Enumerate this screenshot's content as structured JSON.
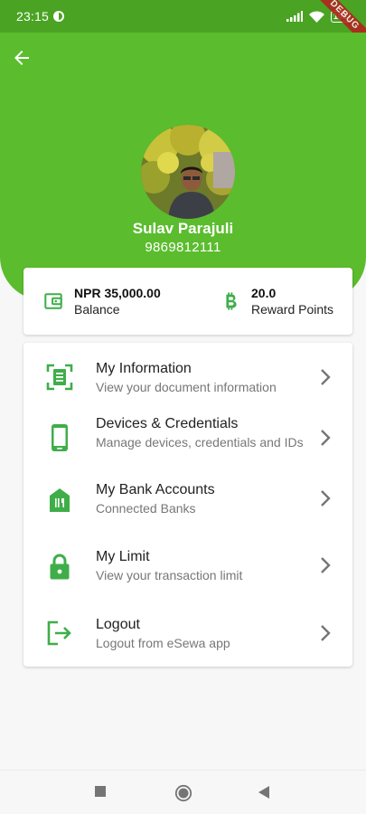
{
  "status": {
    "time": "23:15",
    "battery": "100",
    "debug_banner": "DEBUG"
  },
  "profile": {
    "name": "Sulav Parajuli",
    "phone": "9869812111"
  },
  "balance": {
    "amount": "NPR 35,000.00",
    "label": "Balance"
  },
  "rewards": {
    "amount": "20.0",
    "label": "Reward Points"
  },
  "menu": [
    {
      "title": "My Information",
      "subtitle": "View your document information",
      "icon": "document-scan-icon"
    },
    {
      "title": "Devices & Credentials",
      "subtitle": "Manage devices, credentials and IDs",
      "icon": "smartphone-icon"
    },
    {
      "title": "My Bank Accounts",
      "subtitle": "Connected Banks",
      "icon": "bank-icon"
    },
    {
      "title": "My Limit",
      "subtitle": "View your transaction limit",
      "icon": "lock-icon"
    },
    {
      "title": "Logout",
      "subtitle": "Logout from eSewa app",
      "icon": "logout-icon"
    }
  ],
  "colors": {
    "header": "#5bbc2e",
    "status_bar": "#4aa323",
    "icon_green": "#3fae49",
    "chevron": "#757575"
  }
}
